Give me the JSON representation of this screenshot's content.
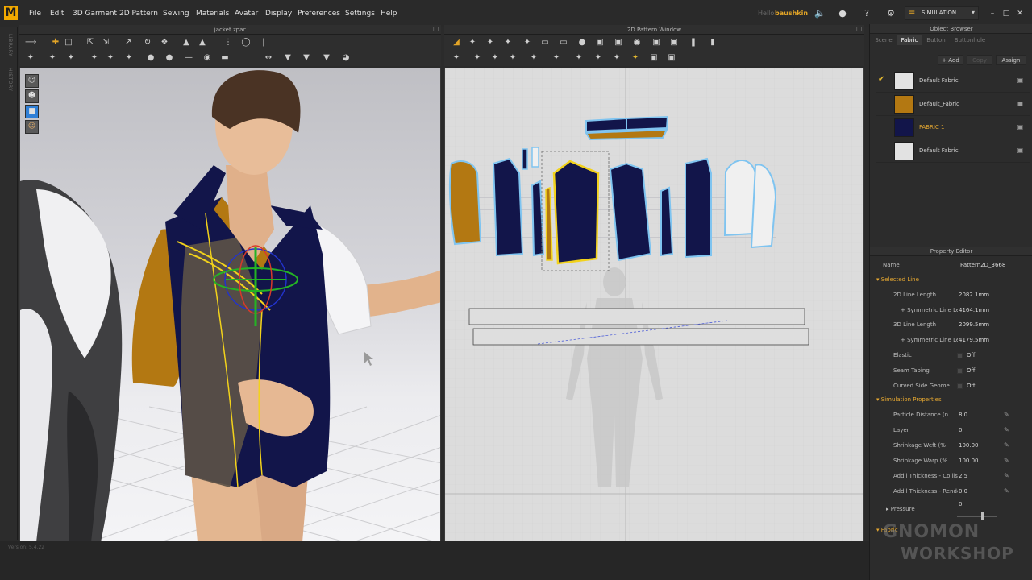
{
  "app": {
    "logo": "M"
  },
  "menu": [
    "File",
    "Edit",
    "3D Garment",
    "2D Pattern",
    "Sewing",
    "Materials",
    "Avatar",
    "Display",
    "Preferences",
    "Settings",
    "Help"
  ],
  "user": {
    "hello": "Hello",
    "name": "baushkin"
  },
  "mode": {
    "label": "SIMULATION"
  },
  "side_tabs": [
    "LIBRARY",
    "HISTORY"
  ],
  "view3d": {
    "title": "jacket.zpac"
  },
  "view2d": {
    "title": "2D Pattern Window"
  },
  "object_browser": {
    "title": "Object Browser",
    "tabs": [
      "Scene",
      "Fabric",
      "Button",
      "Buttonhole"
    ],
    "active_tab": "Fabric",
    "buttons": {
      "add": "+ Add",
      "copy": "Copy",
      "assign": "Assign"
    },
    "fabrics": [
      {
        "name": "Default Fabric",
        "color": "#e2e2e2",
        "checked": true,
        "highlight": false
      },
      {
        "name": "Default_Fabric",
        "color": "#b37812",
        "checked": false,
        "highlight": false
      },
      {
        "name": "FABRIC 1",
        "color": "#12154a",
        "checked": false,
        "highlight": true
      },
      {
        "name": "Default Fabric",
        "color": "#e2e2e2",
        "checked": false,
        "highlight": false
      }
    ]
  },
  "property_editor": {
    "title": "Property Editor",
    "name_label": "Name",
    "name_value": "Pattern2D_3668",
    "selected_line": {
      "label": "Selected Line",
      "rows": [
        {
          "label": "2D Line Length",
          "value": "2082.1mm"
        },
        {
          "label": "+ Symmetric Line Le",
          "value": "4164.1mm"
        },
        {
          "label": "3D Line Length",
          "value": "2099.5mm"
        },
        {
          "label": "+ Symmetric Line Le",
          "value": "4179.5mm"
        },
        {
          "label": "Elastic",
          "value": "Off"
        },
        {
          "label": "Seam Taping",
          "value": "Off"
        },
        {
          "label": "Curved Side Geome",
          "value": "Off"
        }
      ]
    },
    "simulation": {
      "label": "Simulation Properties",
      "rows": [
        {
          "label": "Particle Distance (n",
          "value": "8.0"
        },
        {
          "label": "Layer",
          "value": "0"
        },
        {
          "label": "Shrinkage Weft (%",
          "value": "100.00"
        },
        {
          "label": "Shrinkage Warp (%",
          "value": "100.00"
        },
        {
          "label": "Add'l Thickness - Collisic",
          "value": "2.5"
        },
        {
          "label": "Add'l Thickness - Render",
          "value": "0.0"
        }
      ]
    },
    "pressure": {
      "label": "Pressure",
      "value": "0"
    },
    "fabric_section": {
      "label": "Fabric"
    }
  },
  "status": {
    "version": "Version: 5.4.22"
  },
  "watermark": {
    "line1": "GNOMON",
    "line2": "WORKSHOP"
  },
  "colors": {
    "accent": "#e3a527",
    "navy": "#12154a",
    "mustard": "#b37812",
    "selection": "#f2d21b",
    "outline": "#7fc4f0"
  }
}
